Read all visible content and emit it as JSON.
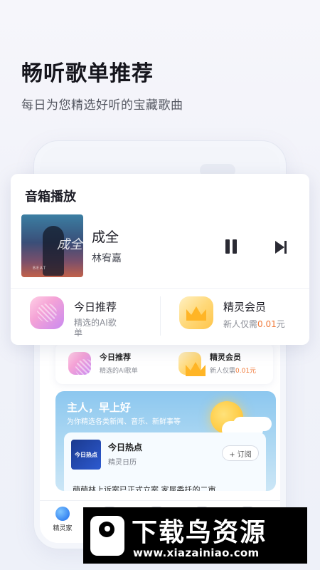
{
  "hero": {
    "title": "畅听歌单推荐",
    "subtitle": "每日为您精选好听的宝藏歌曲"
  },
  "phone": {
    "mini_features": [
      {
        "title": "今日推荐",
        "subtitle": "精选的AI歌单"
      },
      {
        "title": "精灵会员",
        "subtitle_prefix": "新人仅需",
        "price": "0.01元"
      }
    ],
    "greeting": {
      "title": "主人，早上好",
      "subtitle": "为你精选各类新闻、音乐、新鲜事等"
    },
    "hot": {
      "thumb_text": "今日热点",
      "title": "今日热点",
      "subtitle": "精灵日历",
      "subscribe_label": "+ 订阅",
      "news": "萌萌林上诉案已正式立案 家属委托的二审"
    },
    "tabbar": {
      "items": [
        {
          "label": "精灵家"
        }
      ]
    }
  },
  "player": {
    "section_title": "音箱播放",
    "album_script": "成全",
    "album_caption": "BEAT",
    "song_title": "成全",
    "artist": "林宥嘉",
    "features": [
      {
        "title": "今日推荐",
        "subtitle": "精选的AI歌单",
        "icon": "recommend-playlist-icon"
      },
      {
        "title": "精灵会员",
        "subtitle_prefix": "新人仅需",
        "price": "0.01",
        "price_suffix": "元",
        "icon": "crown-icon"
      }
    ]
  },
  "watermark": {
    "title": "下载鸟资源",
    "url": "www.xiazainiao.com"
  },
  "colors": {
    "accent_price": "#f07a3a",
    "greeting_bg": "#8cc7ef",
    "vip_gold": "#ffc54a"
  }
}
